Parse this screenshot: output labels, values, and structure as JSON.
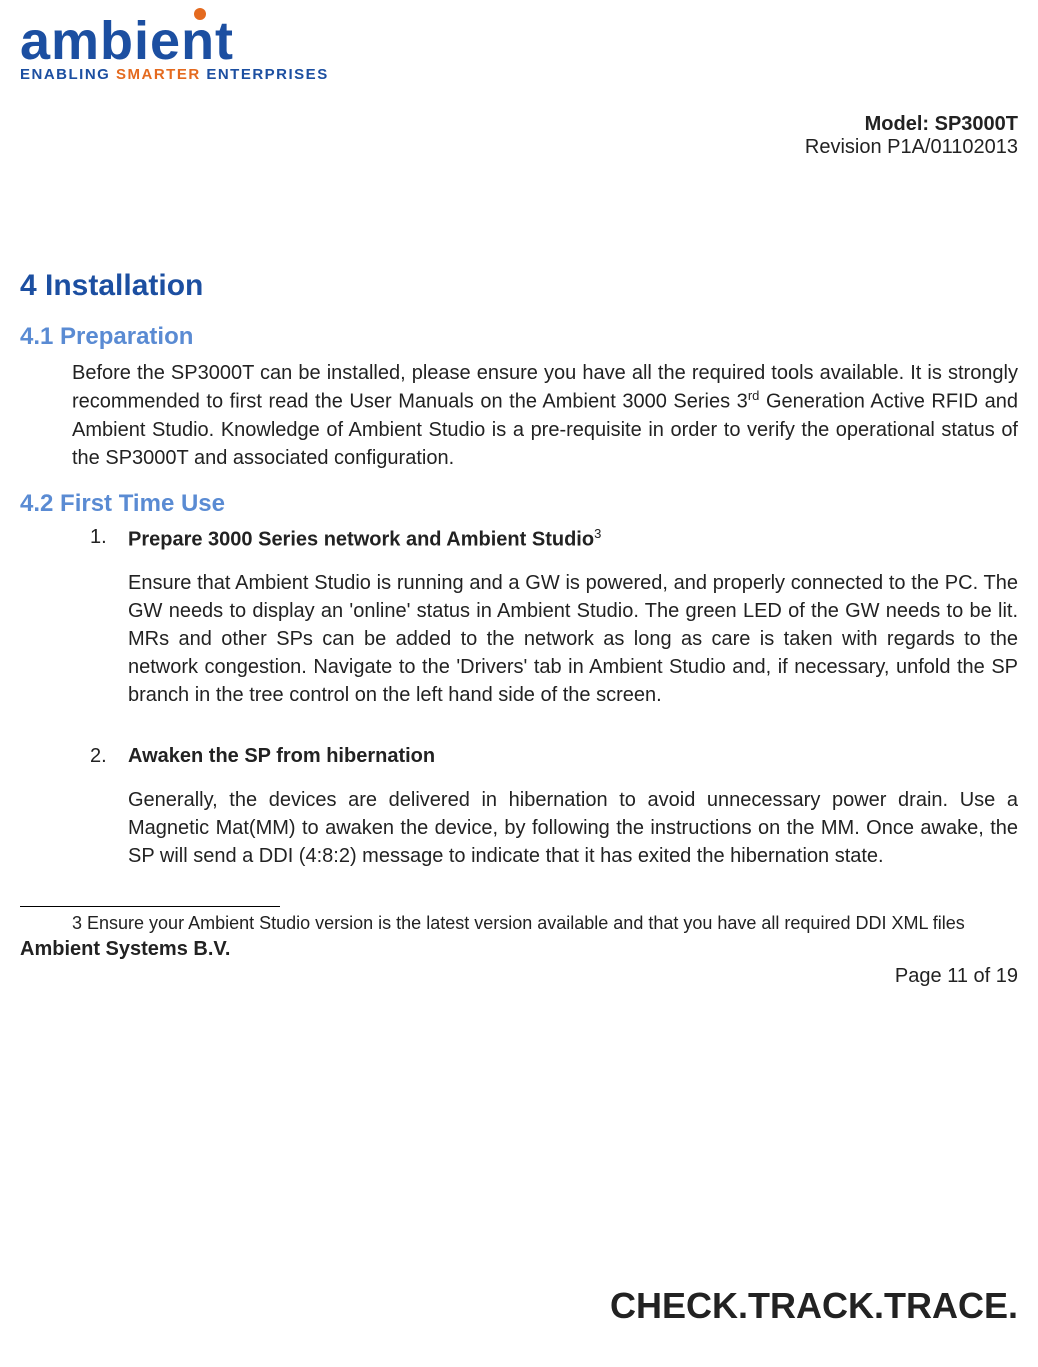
{
  "logo": {
    "word": "ambient",
    "tagline_pre": "ENABLING ",
    "tagline_mid": "SMARTER",
    "tagline_post": " ENTERPRISES"
  },
  "header": {
    "model": "Model: SP3000T",
    "revision": "Revision P1A/01102013"
  },
  "h1": "4  Installation",
  "sec41": {
    "title": "4.1 Preparation",
    "body_pre": "Before the SP3000T can be installed, please ensure you have all the required tools available. It is strongly recommended to first read the User Manuals on the Ambient 3000 Series 3",
    "rd": "rd",
    "body_post": " Generation Active RFID and Ambient Studio. Knowledge of Ambient Studio is a pre-requisite in order to verify the operational status of the SP3000T and associated configuration."
  },
  "sec42": {
    "title": "4.2 First Time Use",
    "item1": {
      "num": "1.",
      "title_pre": "Prepare 3000 Series network and Ambient Studio",
      "sup": "3",
      "body": "Ensure that Ambient Studio is running and a GW is powered, and properly connected to the PC. The GW needs to display an 'online' status in Ambient Studio. The green LED of the GW needs to be lit. MRs and other SPs can be added to the network as long as care is taken with regards to the network congestion. Navigate to the 'Drivers' tab in Ambient Studio and, if necessary, unfold the SP branch in the tree control on the left hand side of the screen."
    },
    "item2": {
      "num": "2.",
      "title": "Awaken the SP from hibernation",
      "body": "Generally, the devices are delivered in hibernation to avoid unnecessary power drain. Use a Magnetic Mat(MM) to awaken the device, by following the instructions on the MM. Once awake, the SP will send a DDI (4:8:2) message to indicate that it has exited the hibernation state."
    }
  },
  "footnote": "3 Ensure your Ambient Studio version is the latest version available and that you have all required DDI XML files",
  "footer": {
    "company": "Ambient Systems B.V.",
    "page": "Page 11 of 19",
    "slogan": "CHECK.TRACK.TRACE."
  }
}
